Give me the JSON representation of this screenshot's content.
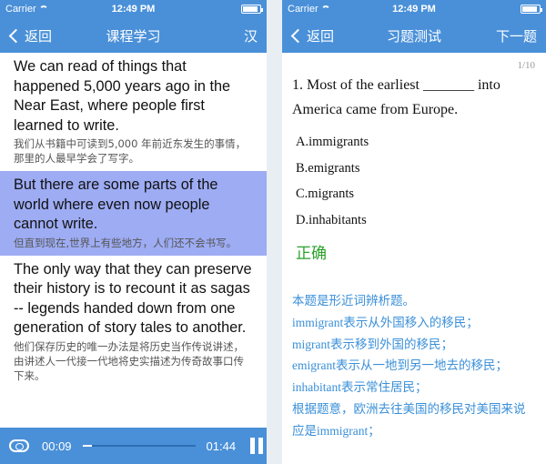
{
  "status": {
    "carrier": "Carrier",
    "time": "12:49 PM",
    "battery_level": 0.9
  },
  "left": {
    "nav": {
      "back_label": "返回",
      "title": "课程学习",
      "right_label": "汉"
    },
    "paragraphs": [
      {
        "en": "We can read of things that happened 5,000 years ago in the Near East, where people first learned to write.",
        "zh": "我们从书籍中可读到5,000 年前近东发生的事情，那里的人最早学会了写字。"
      },
      {
        "en": "But there are some parts of the world where even now people cannot write.",
        "zh": "但直到现在,世界上有些地方，人们还不会书写。"
      },
      {
        "en": "The only way that they can preserve their history is to recount it as sagas -- legends handed down from one generation of story tales to another.",
        "zh": "他们保存历史的唯一办法是将历史当作传说讲述，由讲述人一代接一代地将史实描述为传奇故事口传下来。"
      }
    ],
    "player": {
      "current_time": "00:09",
      "total_time": "01:44",
      "progress": 0.087
    }
  },
  "right": {
    "nav": {
      "back_label": "返回",
      "title": "习题测试",
      "right_label": "下一题"
    },
    "counter": "1/10",
    "question": "1. Most of the earliest _______ into America came from Europe.",
    "options": [
      "A.immigrants",
      "B.emigrants",
      "C.migrants",
      "D.inhabitants"
    ],
    "result": "正确",
    "explanation": [
      "本题是形近词辨析题。",
      "immigrant表示从外国移入的移民；",
      "migrant表示移到外国的移民；",
      "emigrant表示从一地到另一地去的移民；",
      "inhabitant表示常住居民；",
      "根据题意，欧洲去往美国的移民对美国来说应是immigrant；"
    ]
  },
  "colors": {
    "nav": "#4a90d9",
    "highlight": "#9dacf3",
    "correct": "#2aa12a",
    "explain": "#3a8fd8"
  }
}
